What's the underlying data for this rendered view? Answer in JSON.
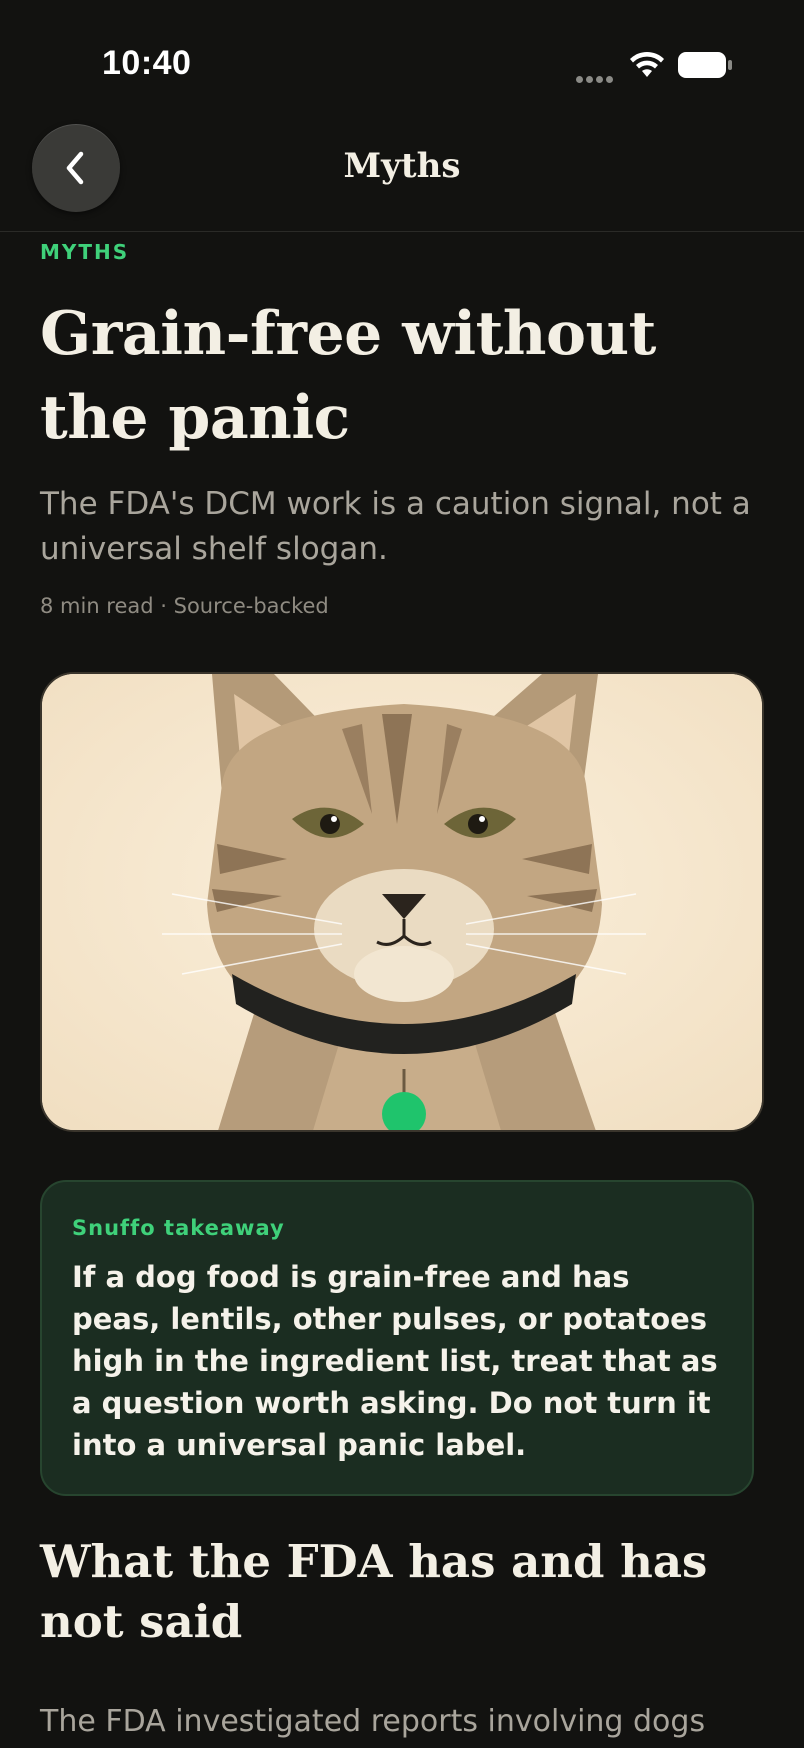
{
  "status_bar": {
    "time": "10:40"
  },
  "nav": {
    "title": "Myths",
    "back_icon": "chevron-left-icon"
  },
  "article": {
    "eyebrow": "MYTHS",
    "headline": "Grain-free without the panic",
    "subtitle": "The FDA's DCM work is a caution signal, not a universal shelf slogan.",
    "meta": "8 min read · Source-backed",
    "hero_image": "cat-illustration"
  },
  "takeaway": {
    "label": "Snuffo takeaway",
    "text": "If a dog food is grain-free and has peas, lentils, other pulses, or potatoes high in the ingredient list, treat that as a question worth asking. Do not turn it into a universal panic label."
  },
  "section": {
    "heading": "What the FDA has and has not said",
    "body": "The FDA investigated reports involving dogs eating certain diets, many labeled grain-free, with peas"
  },
  "colors": {
    "background": "#121210",
    "accent_green": "#3fd17a",
    "card_green": "#1b2d21",
    "text_primary": "#f3efe4",
    "text_secondary": "#a9a59c"
  }
}
